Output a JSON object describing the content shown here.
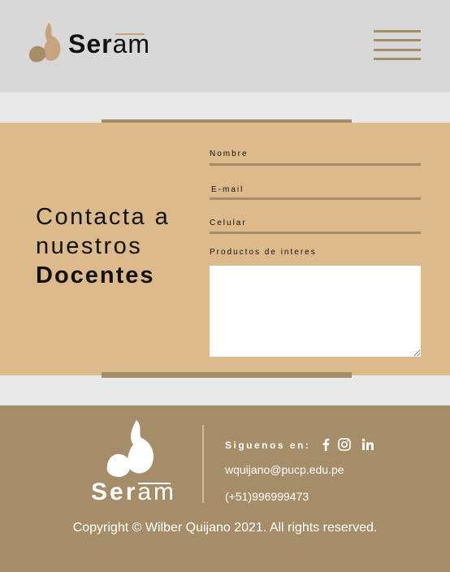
{
  "colors": {
    "header_bg": "#d8d8d8",
    "accent": "#a48d68",
    "sand": "#ddba8b",
    "page_bg": "#e8e8e8",
    "text": "#111111"
  },
  "brand": {
    "logo_bold": "Ser",
    "logo_light": "am"
  },
  "header": {
    "menu_icon": "hamburger-menu-icon"
  },
  "contact": {
    "heading_line1": "Contacta a",
    "heading_line2": "nuestros",
    "heading_strong": "Docentes",
    "fields": {
      "nombre": "Nombre",
      "email": "E-mail",
      "celular": "Celular",
      "productos": "Productos de interes"
    },
    "productos_value": ""
  },
  "footer": {
    "logo_bold": "Ser",
    "logo_light": "am",
    "follow_label": "Siguenos en:",
    "social_icons": [
      "facebook-icon",
      "instagram-icon",
      "linkedin-icon"
    ],
    "email": "wquijano@pucp.edu.pe",
    "phone": "(+51)996999473",
    "copyright": "Copyright © Wilber Quijano 2021. All rights reserved."
  }
}
